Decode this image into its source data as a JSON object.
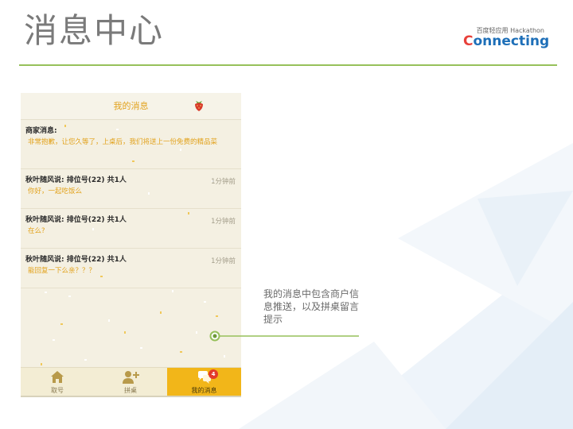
{
  "slide": {
    "title": "消息中心",
    "annotation": "我的消息中包含商户信息推送，以及拼桌留言提示"
  },
  "logo": {
    "top_line": "百度轻应用 Hackathon",
    "word_first": "C",
    "word_rest": "onnecting"
  },
  "phone": {
    "header_title": "我的消息",
    "merchant": {
      "sender": "商家消息:",
      "body": "非常抱歉，让您久等了，上桌后，我们将送上一份免费的精品菜"
    },
    "messages": [
      {
        "sender": "秋叶随风说:   排位号(22) 共1人",
        "time": "1分钟前",
        "body": "你好，一起吃饭么"
      },
      {
        "sender": "秋叶随风说:   排位号(22) 共1人",
        "time": "1分钟前",
        "body": "在么?"
      },
      {
        "sender": "秋叶随风说:   排位号(22) 共1人",
        "time": "1分钟前",
        "body": "能回复一下么亲？？？"
      }
    ],
    "tabs": [
      {
        "label": "取号",
        "icon": "home-icon"
      },
      {
        "label": "拼桌",
        "icon": "add-user-icon"
      },
      {
        "label": "我的消息",
        "icon": "chat-bubbles-icon",
        "badge": "4",
        "active": true
      }
    ]
  },
  "colors": {
    "accent_green": "#96c05a",
    "accent_orange": "#e2a21c",
    "tab_active": "#f2b619",
    "badge_red": "#e33a2a"
  }
}
